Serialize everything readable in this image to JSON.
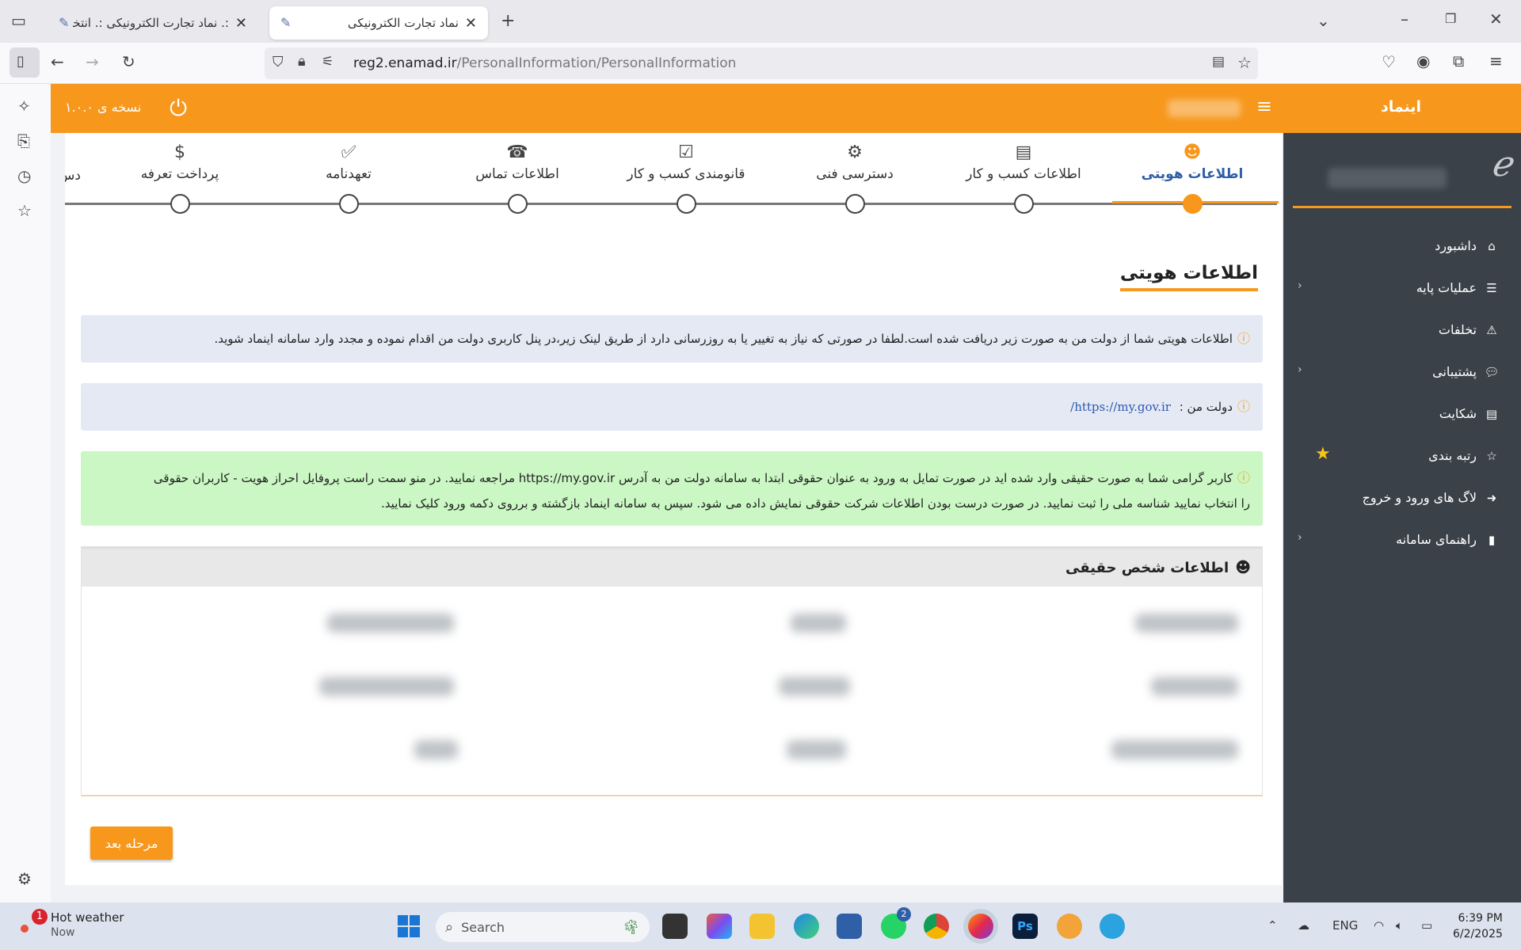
{
  "browser": {
    "tabs": [
      {
        "title": ":. نماد تجارت الکترونیکی :. انتخاب",
        "active": false
      },
      {
        "title": "نماد تجارت الکترونیکی",
        "active": true
      }
    ],
    "url_host": "reg2.enamad.ir",
    "url_path": "/PersonalInformation/PersonalInformation"
  },
  "header": {
    "brand": "اینماد",
    "version": "نسخه ی ۱.۰.۰"
  },
  "sidebar": {
    "items": [
      {
        "label": "داشبورد",
        "icon": "home-icon",
        "chevron": false
      },
      {
        "label": "عملیات پایه",
        "icon": "list-icon",
        "chevron": true
      },
      {
        "label": "تخلفات",
        "icon": "warning-icon",
        "chevron": false
      },
      {
        "label": "پشتیبانی",
        "icon": "chat-icon",
        "chevron": true
      },
      {
        "label": "شکایت",
        "icon": "document-icon",
        "chevron": false
      },
      {
        "label": "رتبه بندی",
        "icon": "star-icon",
        "chevron": false
      },
      {
        "label": "لاگ های ورود و خروج",
        "icon": "arrow-circle-icon",
        "chevron": false
      },
      {
        "label": "راهنمای سامانه",
        "icon": "file-icon",
        "chevron": true
      }
    ]
  },
  "steps": [
    {
      "label": "اطلاعات هویتی",
      "icon": "user-circle-icon",
      "active": true
    },
    {
      "label": "اطلاعات کسب و کار",
      "icon": "file-text-icon",
      "active": false
    },
    {
      "label": "دسترسی فنی",
      "icon": "gears-icon",
      "active": false
    },
    {
      "label": "قانومندی کسب و کار",
      "icon": "check-square-icon",
      "active": false
    },
    {
      "label": "اطلاعات تماس",
      "icon": "phone-icon",
      "active": false
    },
    {
      "label": "تعهدنامه",
      "icon": "checklist-icon",
      "active": false
    },
    {
      "label": "پرداخت تعرفه",
      "icon": "dollar-icon",
      "active": false
    },
    {
      "label": "دس",
      "icon": "",
      "active": false
    }
  ],
  "page": {
    "title": "اطلاعات هویتی",
    "alert1": "اطلاعات هویتی شما از دولت من به صورت زیر دریافت شده است.لطفا در صورتی که نیاز به تغییر یا به روزرسانی دارد از طریق لینک زیر،در پنل کاربری دولت من اقدام نموده و مجدد وارد سامانه اینماد شوید.",
    "alert2_label": "دولت من :",
    "alert2_link": "https://my.gov.ir/",
    "alert3_line1": "کاربر گرامی شما به صورت حقیقی وارد شده اید در صورت تمایل به ورود به عنوان حقوقی ابتدا به سامانه دولت من به آدرس https://my.gov.ir مراجعه نمایید. در منو سمت راست پروفایل احراز هویت - کاربران حقوقی",
    "alert3_line2": "را انتخاب نمایید شناسه ملی را ثبت نمایید. در صورت درست بودن اطلاعات شرکت حقوقی نمایش داده می شود. سپس به سامانه اینماد بازگشته و برروی دکمه ورود کلیک نمایید.",
    "panel_title": "اطلاعات شخص حقیقی",
    "next_button": "مرحله بعد"
  },
  "taskbar": {
    "weather_title": "Hot weather",
    "weather_sub": "Now",
    "weather_badge": "1",
    "search_placeholder": "Search",
    "lang": "ENG",
    "time": "6:39 PM",
    "date": "6/2/2025",
    "whatsapp_badge": "2"
  },
  "colors": {
    "accent": "#f7981d",
    "sidebar_bg": "#3a4149",
    "active_step_text": "#2f5fa7",
    "info_bg": "#e5e9f3",
    "success_bg": "#caf7c3"
  }
}
